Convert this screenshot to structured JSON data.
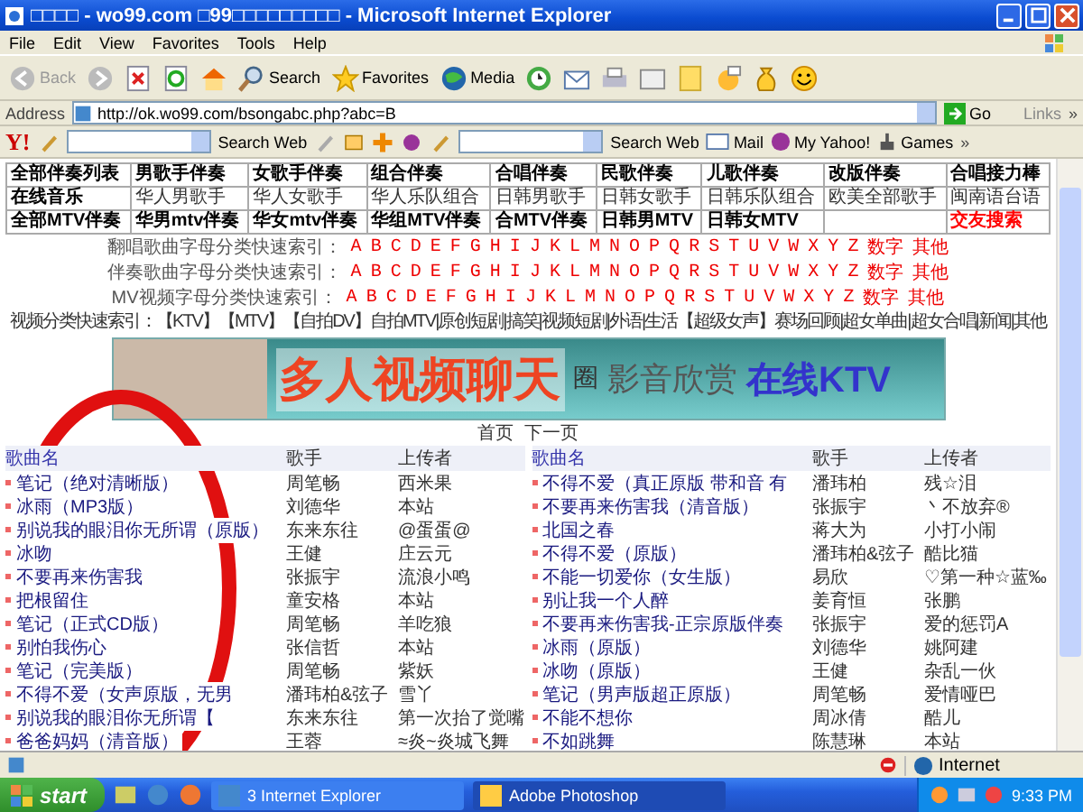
{
  "window": {
    "title": "□□□□ - wo99.com □99□□□□□□□□□ - Microsoft Internet Explorer"
  },
  "menu": [
    "File",
    "Edit",
    "View",
    "Favorites",
    "Tools",
    "Help"
  ],
  "toolbar": {
    "back": "Back",
    "search": "Search",
    "favorites": "Favorites",
    "media": "Media"
  },
  "address_bar": {
    "label": "Address",
    "url": "http://ok.wo99.com/bsongabc.php?abc=B",
    "go": "Go",
    "links": "Links",
    "more": "»"
  },
  "yahoo_bar": {
    "logo": "Y!",
    "search_buttons": [
      "Search Web",
      "Search Web"
    ],
    "mail": "Mail",
    "my_yahoo": "My Yahoo!",
    "games": "Games",
    "more": "»"
  },
  "nav_table": [
    {
      "cells": [
        {
          "text": "全部伴奏列表",
          "bold": true
        },
        {
          "text": "男歌手伴奏",
          "bold": true
        },
        {
          "text": "女歌手伴奏",
          "bold": true
        },
        {
          "text": "组合伴奏",
          "bold": true
        },
        {
          "text": "合唱伴奏",
          "bold": true
        },
        {
          "text": "民歌伴奏",
          "bold": true
        },
        {
          "text": "儿歌伴奏",
          "bold": true
        },
        {
          "text": "改版伴奏",
          "bold": true
        },
        {
          "text": "合唱接力棒",
          "bold": true
        }
      ]
    },
    {
      "cells": [
        {
          "text": "在线音乐",
          "bold": true
        },
        {
          "text": "华人男歌手",
          "bold": false
        },
        {
          "text": "华人女歌手",
          "bold": false
        },
        {
          "text": "华人乐队组合",
          "bold": false
        },
        {
          "text": "日韩男歌手",
          "bold": false
        },
        {
          "text": "日韩女歌手",
          "bold": false
        },
        {
          "text": "日韩乐队组合",
          "bold": false
        },
        {
          "text": "欧美全部歌手",
          "bold": false
        },
        {
          "text": "闽南语台语",
          "bold": false
        }
      ]
    },
    {
      "cells": [
        {
          "text": "全部MTV伴奏",
          "bold": true
        },
        {
          "text": "华男mtv伴奏",
          "bold": true
        },
        {
          "text": "华女mtv伴奏",
          "bold": true
        },
        {
          "text": "华组MTV伴奏",
          "bold": true
        },
        {
          "text": "合MTV伴奏",
          "bold": true
        },
        {
          "text": "日韩男MTV",
          "bold": true
        },
        {
          "text": "日韩女MTV",
          "bold": true
        },
        {},
        {
          "text": "交友搜索",
          "bold": true,
          "color": "#ff0000"
        }
      ]
    }
  ],
  "letter_indexes": [
    {
      "label": "翻唱歌曲字母分类快速索引：",
      "links": [
        "A",
        "B",
        "C",
        "D",
        "E",
        "F",
        "G",
        "H",
        "I",
        "J",
        "K",
        "L",
        "M",
        "N",
        "O",
        "P",
        "Q",
        "R",
        "S",
        "T",
        "U",
        "V",
        "W",
        "X",
        "Y",
        "Z",
        "数字",
        "其他"
      ]
    },
    {
      "label": "伴奏歌曲字母分类快速索引：",
      "links": [
        "A",
        "B",
        "C",
        "D",
        "E",
        "F",
        "G",
        "H",
        "I",
        "J",
        "K",
        "L",
        "M",
        "N",
        "O",
        "P",
        "Q",
        "R",
        "S",
        "T",
        "U",
        "V",
        "W",
        "X",
        "Y",
        "Z",
        "数字",
        "其他"
      ]
    },
    {
      "label": "MV视频字母分类快速索引：",
      "links": [
        "A",
        "B",
        "C",
        "D",
        "E",
        "F",
        "G",
        "H",
        "I",
        "J",
        "K",
        "L",
        "M",
        "N",
        "O",
        "P",
        "Q",
        "R",
        "S",
        "T",
        "U",
        "V",
        "W",
        "X",
        "Y",
        "Z",
        "数字",
        "其他"
      ]
    }
  ],
  "video_index": "视频分类快速索引：【KTV】【MTV】【自拍DV】自拍MTV|原创短剧|搞笑|视频短剧|外语|生活【超级女声】赛场回顾|超女单曲|超女合唱|新闻|其他",
  "banner": {
    "headline": "多人视频聊天",
    "badge": "圈",
    "subtitle": "影音欣赏",
    "ktv": "在线KTV"
  },
  "paging": [
    "首页",
    "下一页"
  ],
  "song_columns_left": [
    "歌曲名",
    "歌手",
    "上传者"
  ],
  "song_columns_right": [
    "歌曲名",
    "歌手",
    "上传者"
  ],
  "songs_left": [
    {
      "title": "笔记（绝对清晰版）",
      "singer": "周笔畅",
      "uploader": "西米果"
    },
    {
      "title": "冰雨（MP3版）",
      "singer": "刘德华",
      "uploader": "本站"
    },
    {
      "title": "别说我的眼泪你无所谓（原版）",
      "singer": "东来东往",
      "uploader": "@蛋蛋@"
    },
    {
      "title": "冰吻",
      "singer": "王健",
      "uploader": "庄云元"
    },
    {
      "title": "不要再来伤害我",
      "singer": "张振宇",
      "uploader": "流浪小鸣"
    },
    {
      "title": "把根留住",
      "singer": "童安格",
      "uploader": "本站"
    },
    {
      "title": "笔记（正式CD版）",
      "singer": "周笔畅",
      "uploader": "羊吃狼"
    },
    {
      "title": "别怕我伤心",
      "singer": "张信哲",
      "uploader": "本站"
    },
    {
      "title": "笔记（完美版）",
      "singer": "周笔畅",
      "uploader": "紫妖"
    },
    {
      "title": "不得不爱（女声原版，无男",
      "singer": "潘玮柏&弦子",
      "uploader": "雪丫"
    },
    {
      "title": "别说我的眼泪你无所谓【",
      "singer": "东来东往",
      "uploader": "第一次抬了觉嘴"
    },
    {
      "title": "爸爸妈妈（清音版）",
      "singer": "王蓉",
      "uploader": "≈炎~炎城飞舞"
    }
  ],
  "songs_right": [
    {
      "title": "不得不爱（真正原版 带和音 有",
      "singer": "潘玮柏",
      "uploader": "残☆泪"
    },
    {
      "title": "不要再来伤害我（清音版）",
      "singer": "张振宇",
      "uploader": "丶不放弃®"
    },
    {
      "title": "北国之春",
      "singer": "蒋大为",
      "uploader": "小打小闹"
    },
    {
      "title": "不得不爱（原版）",
      "singer": "潘玮柏&弦子",
      "uploader": "酷比猫"
    },
    {
      "title": "不能一切爱你（女生版）",
      "singer": "易欣",
      "uploader": "♡第一种☆蓝‰"
    },
    {
      "title": "别让我一个人醉",
      "singer": "姜育恒",
      "uploader": "张鹏"
    },
    {
      "title": "不要再来伤害我-正宗原版伴奏",
      "singer": "张振宇",
      "uploader": "爱的惩罚A"
    },
    {
      "title": "冰雨（原版）",
      "singer": "刘德华",
      "uploader": "姚阿建"
    },
    {
      "title": "冰吻（原版）",
      "singer": "王健",
      "uploader": "杂乱一伙"
    },
    {
      "title": "笔记（男声版超正原版）",
      "singer": "周笔畅",
      "uploader": "爱情哑巴"
    },
    {
      "title": "不能不想你",
      "singer": "周冰倩",
      "uploader": "酷儿"
    },
    {
      "title": "不如跳舞",
      "singer": "陈慧琳",
      "uploader": "本站"
    }
  ],
  "status_bar": {
    "zone": "Internet"
  },
  "taskbar": {
    "start": "start",
    "tasks": [
      {
        "label": "3 Internet Explorer",
        "selected": false
      },
      {
        "label": "Adobe Photoshop",
        "selected": true
      }
    ],
    "clock": "9:33 PM"
  }
}
